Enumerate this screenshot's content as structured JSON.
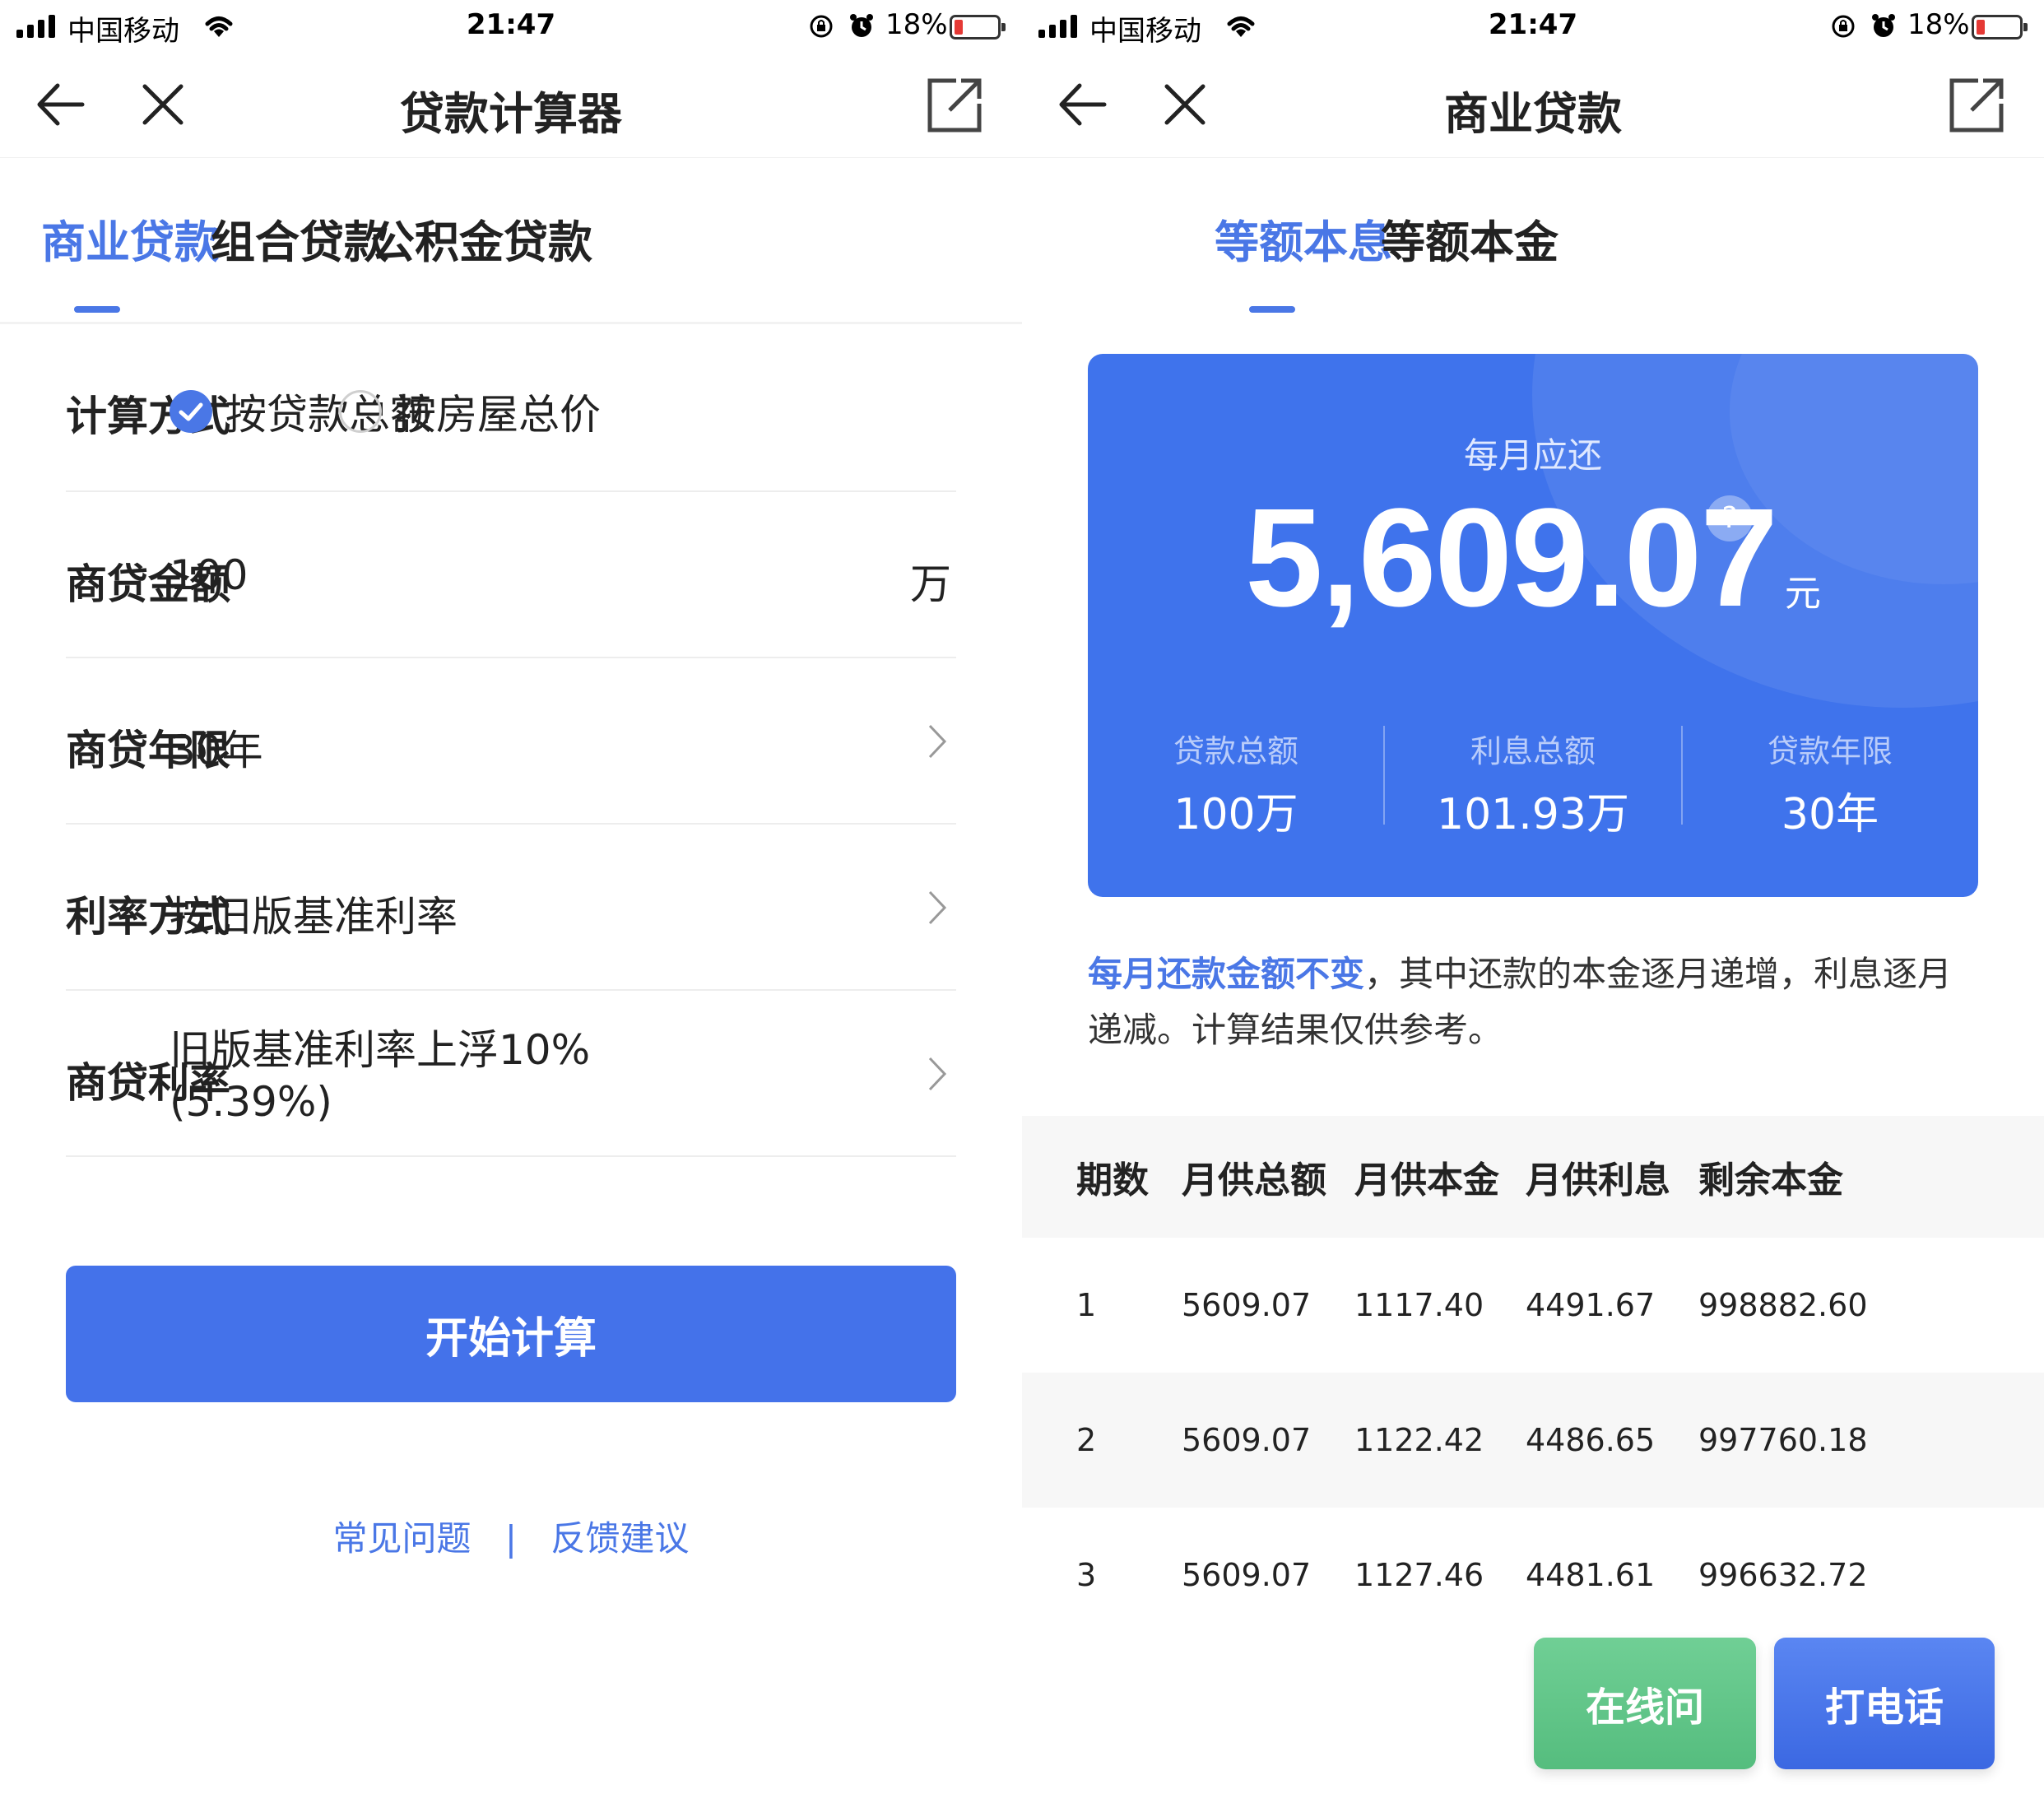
{
  "status_bar": {
    "carrier": "中国移动",
    "time": "21:47",
    "battery_percent": "18%"
  },
  "left": {
    "nav": {
      "title": "贷款计算器"
    },
    "tabs": [
      {
        "label": "商业贷款",
        "active": true
      },
      {
        "label": "组合贷款",
        "active": false
      },
      {
        "label": "公积金贷款",
        "active": false
      }
    ],
    "form": {
      "calc_method": {
        "label": "计算方式",
        "options": [
          {
            "label": "按贷款总额",
            "selected": true
          },
          {
            "label": "按房屋总价",
            "selected": false
          }
        ]
      },
      "amount": {
        "label": "商贷金额",
        "value": "100",
        "unit": "万"
      },
      "term": {
        "label": "商贷年限",
        "value": "30年"
      },
      "rate_method": {
        "label": "利率方式",
        "value": "按旧版基准利率"
      },
      "rate": {
        "label": "商贷利率",
        "value_line1": "旧版基准利率上浮10%",
        "value_line2": "(5.39%)"
      }
    },
    "calculate_label": "开始计算",
    "links": {
      "faq": "常见问题",
      "separator": "|",
      "feedback": "反馈建议"
    }
  },
  "right": {
    "nav": {
      "title": "商业贷款"
    },
    "tabs": [
      {
        "label": "等额本息",
        "active": true
      },
      {
        "label": "等额本金",
        "active": false
      }
    ],
    "result": {
      "caption": "每月应还",
      "monthly_payment": "5,609.07",
      "unit": "元",
      "help": "?",
      "stats": [
        {
          "label": "贷款总额",
          "value": "100万"
        },
        {
          "label": "利息总额",
          "value": "101.93万"
        },
        {
          "label": "贷款年限",
          "value": "30年"
        }
      ]
    },
    "note": {
      "highlight": "每月还款金额不变",
      "text": "，其中还款的本金逐月递增，利息逐月递减。计算结果仅供参考。"
    },
    "table": {
      "headers": [
        "期数",
        "月供总额",
        "月供本金",
        "月供利息",
        "剩余本金"
      ],
      "rows": [
        [
          "1",
          "5609.07",
          "1117.40",
          "4491.67",
          "998882.60"
        ],
        [
          "2",
          "5609.07",
          "1122.42",
          "4486.65",
          "997760.18"
        ],
        [
          "3",
          "5609.07",
          "1127.46",
          "4481.61",
          "996632.72"
        ]
      ]
    },
    "actions": {
      "online": "在线问",
      "call": "打电话"
    }
  },
  "colors": {
    "accent": "#4a77e6",
    "primary_button": "#4472ea",
    "online_button": "#5fc487"
  }
}
